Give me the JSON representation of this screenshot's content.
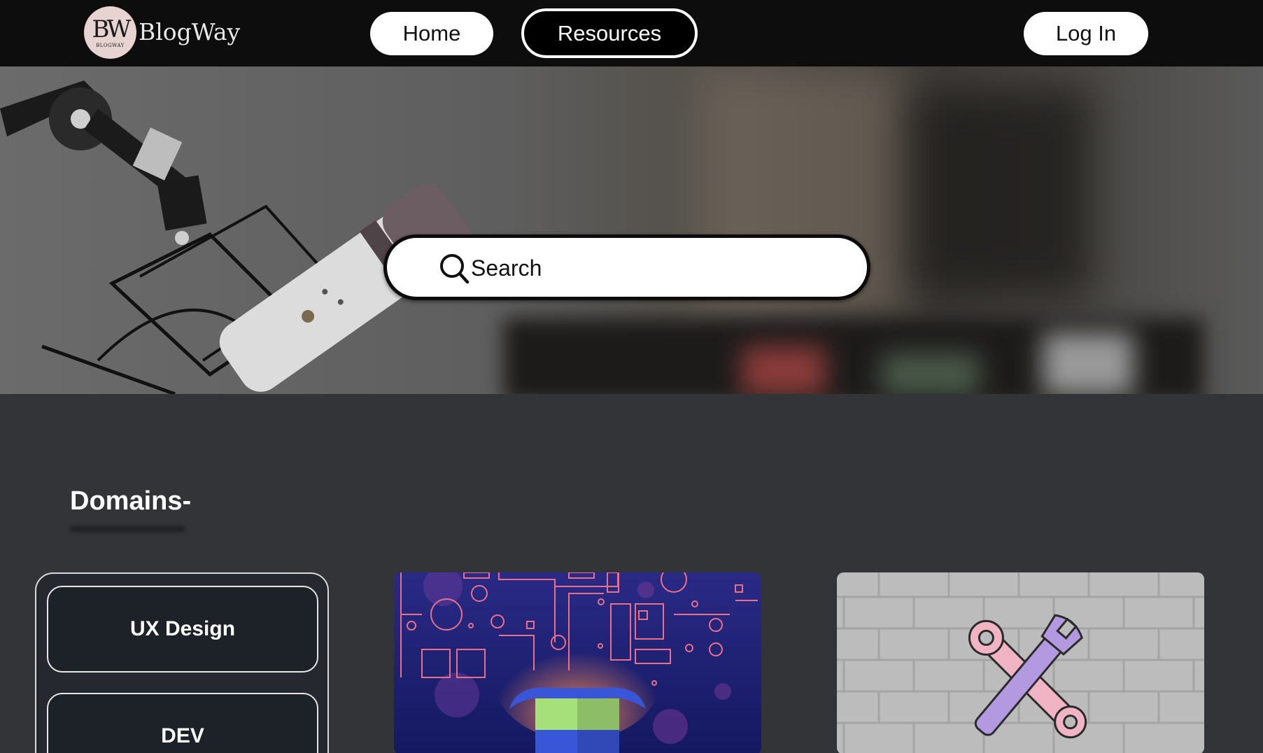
{
  "header": {
    "logo_monogram": "BW",
    "logo_subtext": "BLOGWAY",
    "logo_text": "BlogWay",
    "nav": {
      "home": "Home",
      "resources": "Resources",
      "login": "Log In"
    }
  },
  "hero": {
    "search_placeholder": "Search"
  },
  "domains": {
    "title": "Domains-",
    "items": [
      {
        "label": "UX Design"
      },
      {
        "label": "DEV"
      }
    ]
  },
  "colors": {
    "header_bg": "#0d0d0d",
    "page_bg": "#333438",
    "domain_item_bg": "#1d2229"
  },
  "icons": [
    "search-icon",
    "wrench-cross-icon",
    "magic-hat-icon"
  ]
}
